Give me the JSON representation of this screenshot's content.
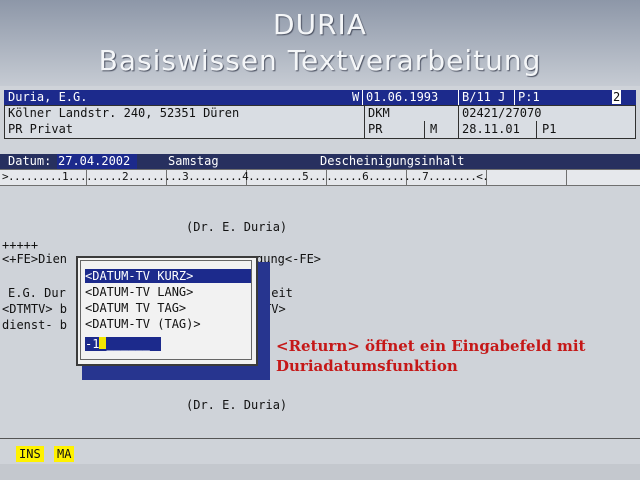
{
  "banner": {
    "line1": "DURIA",
    "line2": "Basiswissen Textverarbeitung"
  },
  "record": {
    "name": "Duria, E.G.",
    "flag": "W",
    "date": "01.06.1993",
    "code": "B/11 J",
    "page": "P:1",
    "num": "2",
    "address": "Kölner Landstr. 240, 52351 Düren",
    "insurer": "DKM",
    "phone": "02421/27070",
    "status": "PR Privat",
    "pr": "PR",
    "m": "M",
    "date2": "28.11.01",
    "p1": "P1"
  },
  "datum_bar": {
    "label": "Datum:",
    "value": "27.04.2002",
    "weekday": "Samstag",
    "title": "Descheinigungsinhalt"
  },
  "ruler": {
    "text": ">.........1.........2.........3.........4.........5.........6.........7........<."
  },
  "document": {
    "sig_top": "(Dr. E. Duria)",
    "plus": "+++++",
    "line_fe_start": "<+FE>Dien",
    "line_fe_end": "gung<-FE>",
    "line_eg_start": "E.G. Dur",
    "line_eg_end": "seit",
    "line_dtmtv_start": "<DTMTV> b",
    "line_dtmtv_end": "TV>",
    "line_dienst_start": "dienst- b",
    "line_dienst_end": ".",
    "sig_bottom": "(Dr. E. Duria)"
  },
  "popup": {
    "items": [
      "<DATUM-TV KURZ>",
      "<DATUM-TV LANG>",
      "<DATUM TV TAG>",
      "<DATUM-TV (TAG)>"
    ],
    "input_value": "-1"
  },
  "annotation": {
    "line1": "<Return> öffnet ein Eingabefeld mit",
    "line2": "Duriadatumsfunktion"
  },
  "status": {
    "ins": "INS",
    "ma": "MA"
  },
  "colors": {
    "highlight_blue": "#1c2a8c",
    "annotation_red": "#c51818",
    "status_yellow": "#fff200"
  }
}
